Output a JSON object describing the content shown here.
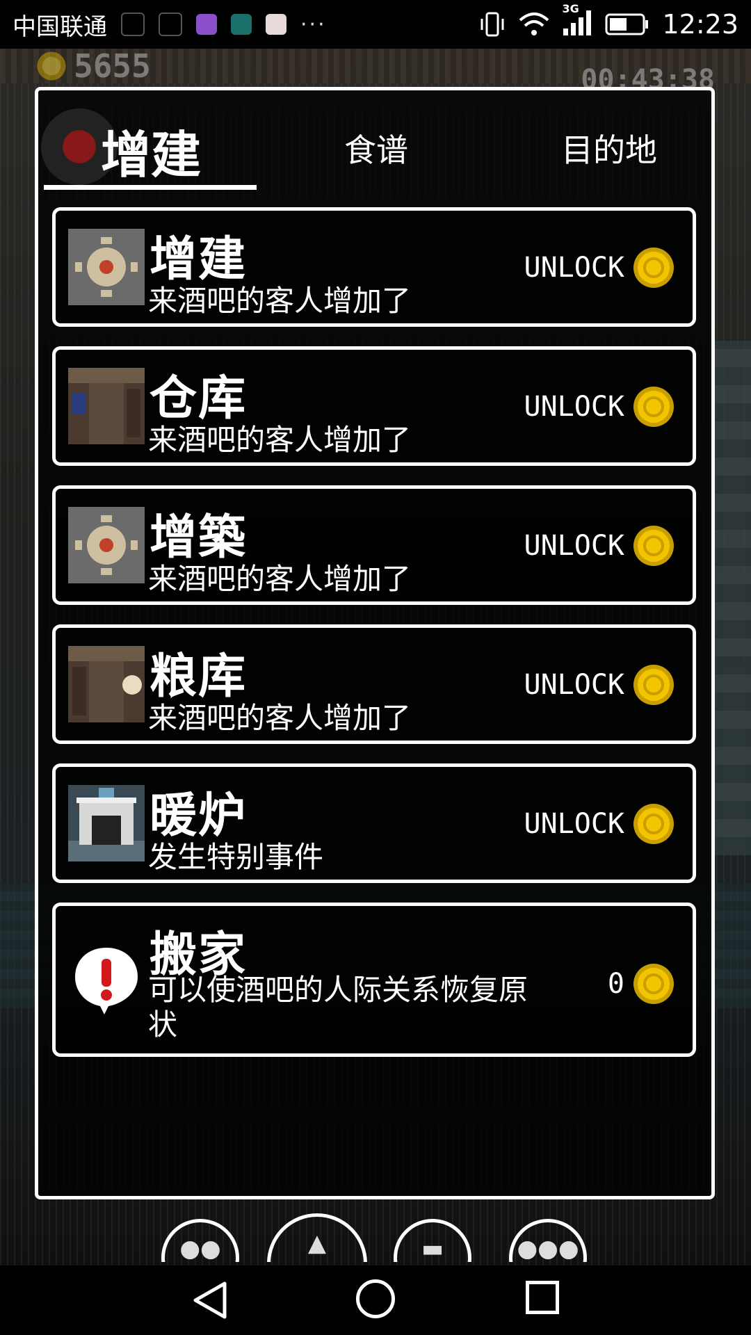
{
  "status_bar": {
    "carrier": "中国联通",
    "network": "3G",
    "time": "12:23",
    "overflow": "···"
  },
  "hud": {
    "coins": "5655",
    "timer": "00:43:38"
  },
  "tabs": {
    "active": "增建",
    "recipe": "食谱",
    "destination": "目的地"
  },
  "items": [
    {
      "title": "增建",
      "desc": "来酒吧的客人增加了",
      "price": "UNLOCK",
      "icon": "table-icon"
    },
    {
      "title": "仓库",
      "desc": "来酒吧的客人增加了",
      "price": "UNLOCK",
      "icon": "warehouse-icon"
    },
    {
      "title": "增築",
      "desc": "来酒吧的客人增加了",
      "price": "UNLOCK",
      "icon": "table-icon"
    },
    {
      "title": "粮库",
      "desc": "来酒吧的客人增加了",
      "price": "UNLOCK",
      "icon": "granary-icon"
    },
    {
      "title": "暖炉",
      "desc": "发生特别事件",
      "price": "UNLOCK",
      "icon": "fireplace-icon"
    },
    {
      "title": "搬家",
      "desc": "可以使酒吧的人际关系恢复原状",
      "price": "0",
      "icon": "alert-icon"
    }
  ],
  "colors": {
    "coin": "#f2c500",
    "panel_border": "#ffffff",
    "background": "#000000"
  }
}
